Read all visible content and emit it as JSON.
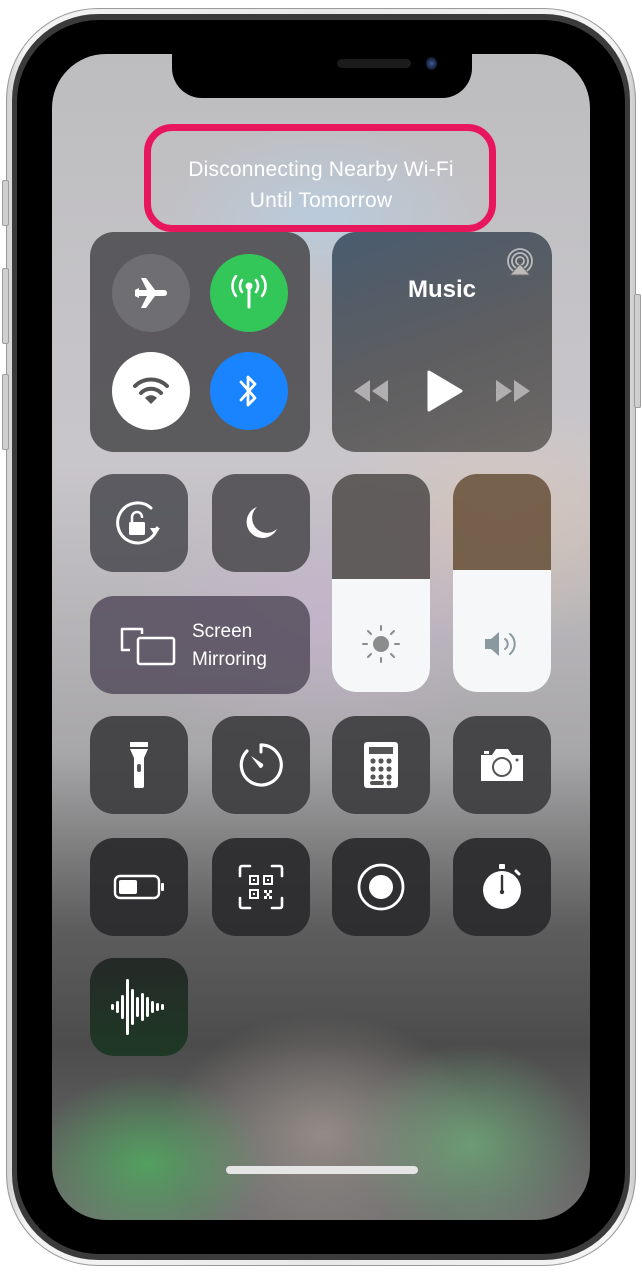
{
  "status_banner": {
    "line1": "Disconnecting Nearby Wi-Fi",
    "line2": "Until Tomorrow",
    "highlight_color": "#e8175d"
  },
  "connectivity": {
    "airplane": {
      "icon": "airplane-icon",
      "state": "off"
    },
    "cellular": {
      "icon": "cellular-antenna-icon",
      "state": "on",
      "color": "#33c759"
    },
    "wifi": {
      "icon": "wifi-icon",
      "state": "disconnected-until-tomorrow"
    },
    "bluetooth": {
      "icon": "bluetooth-icon",
      "state": "on",
      "color": "#1a84ff"
    }
  },
  "music": {
    "title": "Music",
    "controls": [
      "rewind-icon",
      "play-icon",
      "fast-forward-icon"
    ],
    "airplay_icon": "airplay-audio-icon"
  },
  "toggles": {
    "orientation_lock": {
      "icon": "rotation-lock-icon"
    },
    "do_not_disturb": {
      "icon": "moon-icon"
    },
    "screen_mirroring": {
      "line1": "Screen",
      "line2": "Mirroring",
      "icon": "screen-mirroring-icon"
    }
  },
  "sliders": {
    "brightness": {
      "icon": "sun-icon",
      "level": 0.52
    },
    "volume": {
      "icon": "speaker-icon",
      "level": 0.56
    }
  },
  "shortcuts": [
    {
      "name": "flashlight",
      "icon": "flashlight-icon"
    },
    {
      "name": "timer",
      "icon": "timer-icon"
    },
    {
      "name": "calculator",
      "icon": "calculator-icon"
    },
    {
      "name": "camera",
      "icon": "camera-icon"
    },
    {
      "name": "low-power-mode",
      "icon": "battery-icon"
    },
    {
      "name": "qr-code-scanner",
      "icon": "qr-code-icon"
    },
    {
      "name": "screen-recording",
      "icon": "record-icon"
    },
    {
      "name": "stopwatch",
      "icon": "stopwatch-icon"
    },
    {
      "name": "voice-memos",
      "icon": "waveform-icon"
    }
  ]
}
